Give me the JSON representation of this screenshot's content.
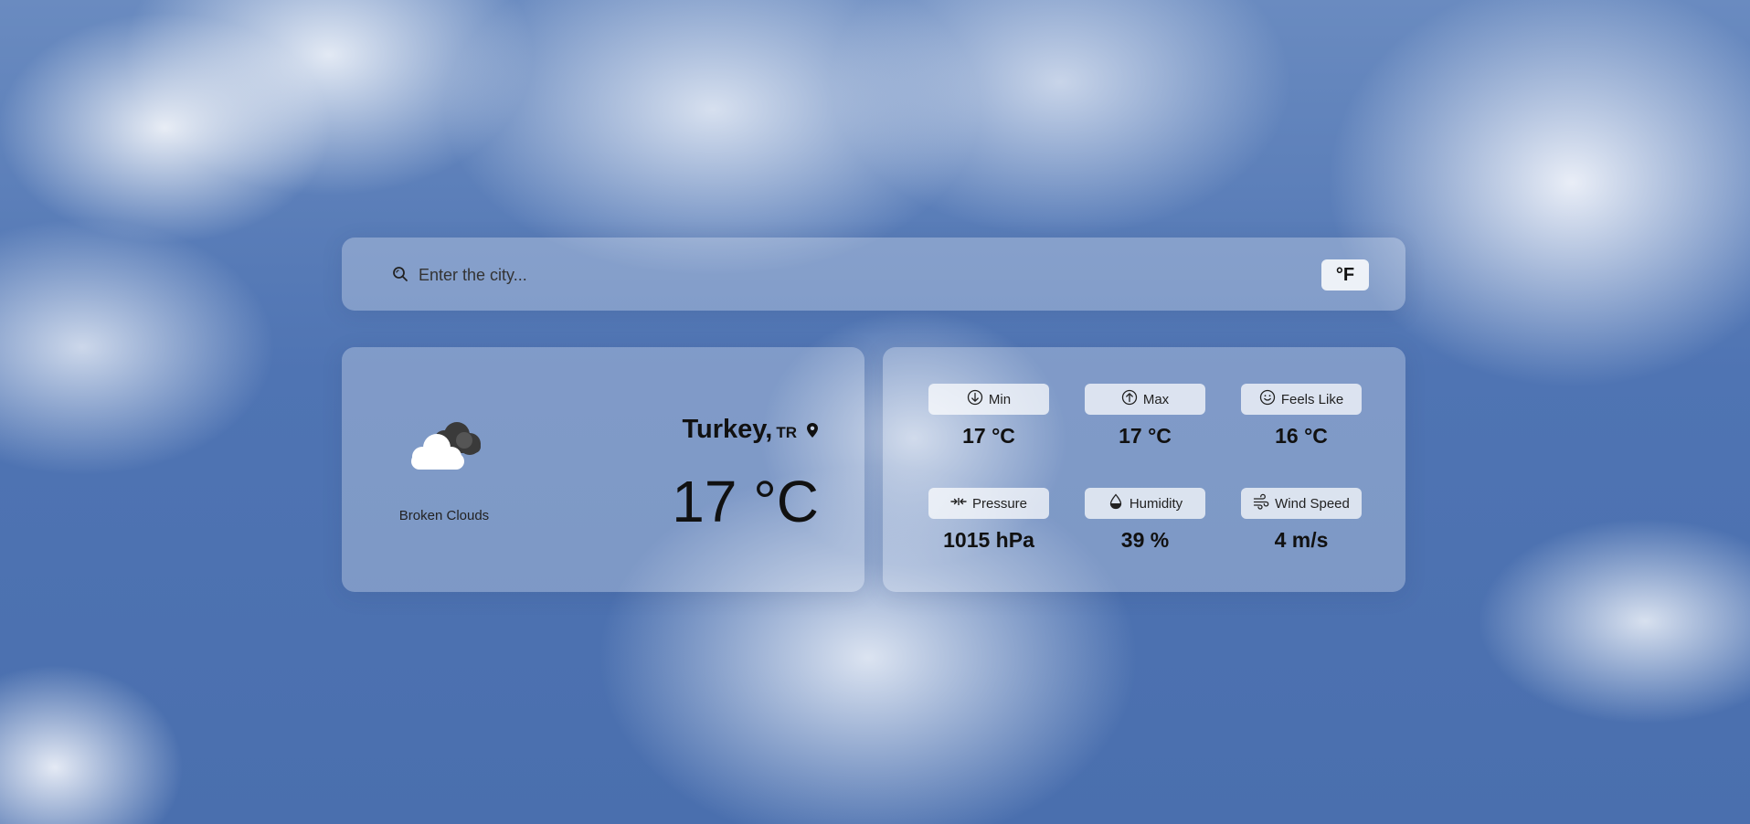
{
  "search": {
    "placeholder": "Enter the city...",
    "value": "",
    "unit_toggle_label": "°F"
  },
  "current": {
    "condition": "Broken Clouds",
    "condition_icon": "broken-clouds-icon",
    "city": "Turkey,",
    "country": "TR",
    "temperature": "17 °C"
  },
  "stats": [
    {
      "label": "Min",
      "value": "17 °C",
      "icon": "arrow-down-circle-icon"
    },
    {
      "label": "Max",
      "value": "17 °C",
      "icon": "arrow-up-circle-icon"
    },
    {
      "label": "Feels Like",
      "value": "16 °C",
      "icon": "smiley-icon"
    },
    {
      "label": "Pressure",
      "value": "1015 hPa",
      "icon": "compress-arrows-icon"
    },
    {
      "label": "Humidity",
      "value": "39 %",
      "icon": "water-drop-icon"
    },
    {
      "label": "Wind Speed",
      "value": "4 m/s",
      "icon": "wind-icon"
    }
  ],
  "colors": {
    "sky": "#4f74b3",
    "card": "rgba(255,255,255,0.28)",
    "chip": "rgba(255,255,255,0.72)"
  }
}
